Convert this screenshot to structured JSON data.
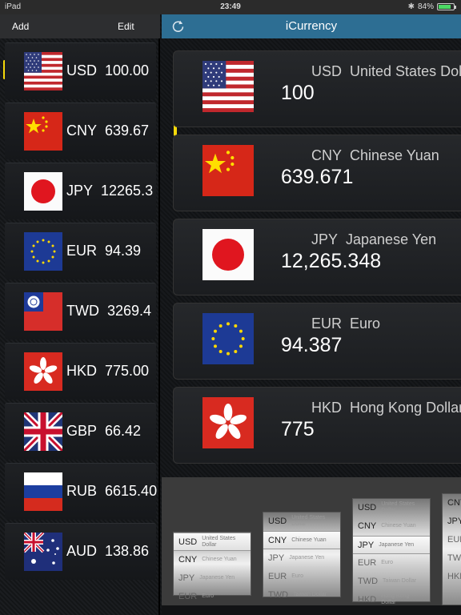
{
  "status": {
    "device": "iPad",
    "time": "23:49",
    "battery": "84%",
    "battery_level": 0.84
  },
  "left_nav": {
    "add": "Add",
    "edit": "Edit"
  },
  "right_nav": {
    "title": "iCurrency"
  },
  "sidebar": [
    {
      "code": "USD",
      "value": "100.00"
    },
    {
      "code": "CNY",
      "value": "639.67"
    },
    {
      "code": "JPY",
      "value": "12265.3"
    },
    {
      "code": "EUR",
      "value": "94.39"
    },
    {
      "code": "TWD",
      "value": "3269.4"
    },
    {
      "code": "HKD",
      "value": "775.00"
    },
    {
      "code": "GBP",
      "value": "66.42"
    },
    {
      "code": "RUB",
      "value": "6615.40"
    },
    {
      "code": "AUD",
      "value": "138.86"
    }
  ],
  "cards": [
    {
      "code": "USD",
      "name": "United States Dollar",
      "value": "100"
    },
    {
      "code": "CNY",
      "name": "Chinese Yuan",
      "value": "639.671"
    },
    {
      "code": "JPY",
      "name": "Japanese Yen",
      "value": "12,265.348"
    },
    {
      "code": "EUR",
      "name": "Euro",
      "value": "94.387"
    },
    {
      "code": "HKD",
      "name": "Hong Kong Dollar",
      "value": "775"
    }
  ],
  "picker": [
    {
      "rows": [
        {
          "code": "USD",
          "name": "United States Dollar",
          "sel": true
        },
        {
          "code": "CNY",
          "name": "Chinese Yuan"
        },
        {
          "code": "JPY",
          "name": "Japanese Yen"
        },
        {
          "code": "EUR",
          "name": "Euro"
        }
      ]
    },
    {
      "rows": [
        {
          "code": "USD",
          "name": "United States Dollar"
        },
        {
          "code": "CNY",
          "name": "Chinese Yuan",
          "sel": true
        },
        {
          "code": "JPY",
          "name": "Japanese Yen"
        },
        {
          "code": "EUR",
          "name": "Euro"
        },
        {
          "code": "TWD",
          "name": "Taiwan Dollar"
        }
      ]
    },
    {
      "rows": [
        {
          "code": "USD",
          "name": "United States Dollar"
        },
        {
          "code": "CNY",
          "name": "Chinese Yuan"
        },
        {
          "code": "JPY",
          "name": "Japanese Yen",
          "sel": true
        },
        {
          "code": "EUR",
          "name": "Euro"
        },
        {
          "code": "TWD",
          "name": "Taiwan Dollar"
        },
        {
          "code": "HKD",
          "name": "Hong Kong Dollar"
        }
      ]
    },
    {
      "rows": [
        {
          "code": "CNY",
          "name": ""
        },
        {
          "code": "JPY",
          "name": ""
        },
        {
          "code": "EUR",
          "name": ""
        },
        {
          "code": "TWD",
          "name": ""
        },
        {
          "code": "HKD",
          "name": ""
        }
      ]
    }
  ],
  "colors": {
    "nav_blue": "#2d6e93",
    "selection": "#f5d90a"
  }
}
